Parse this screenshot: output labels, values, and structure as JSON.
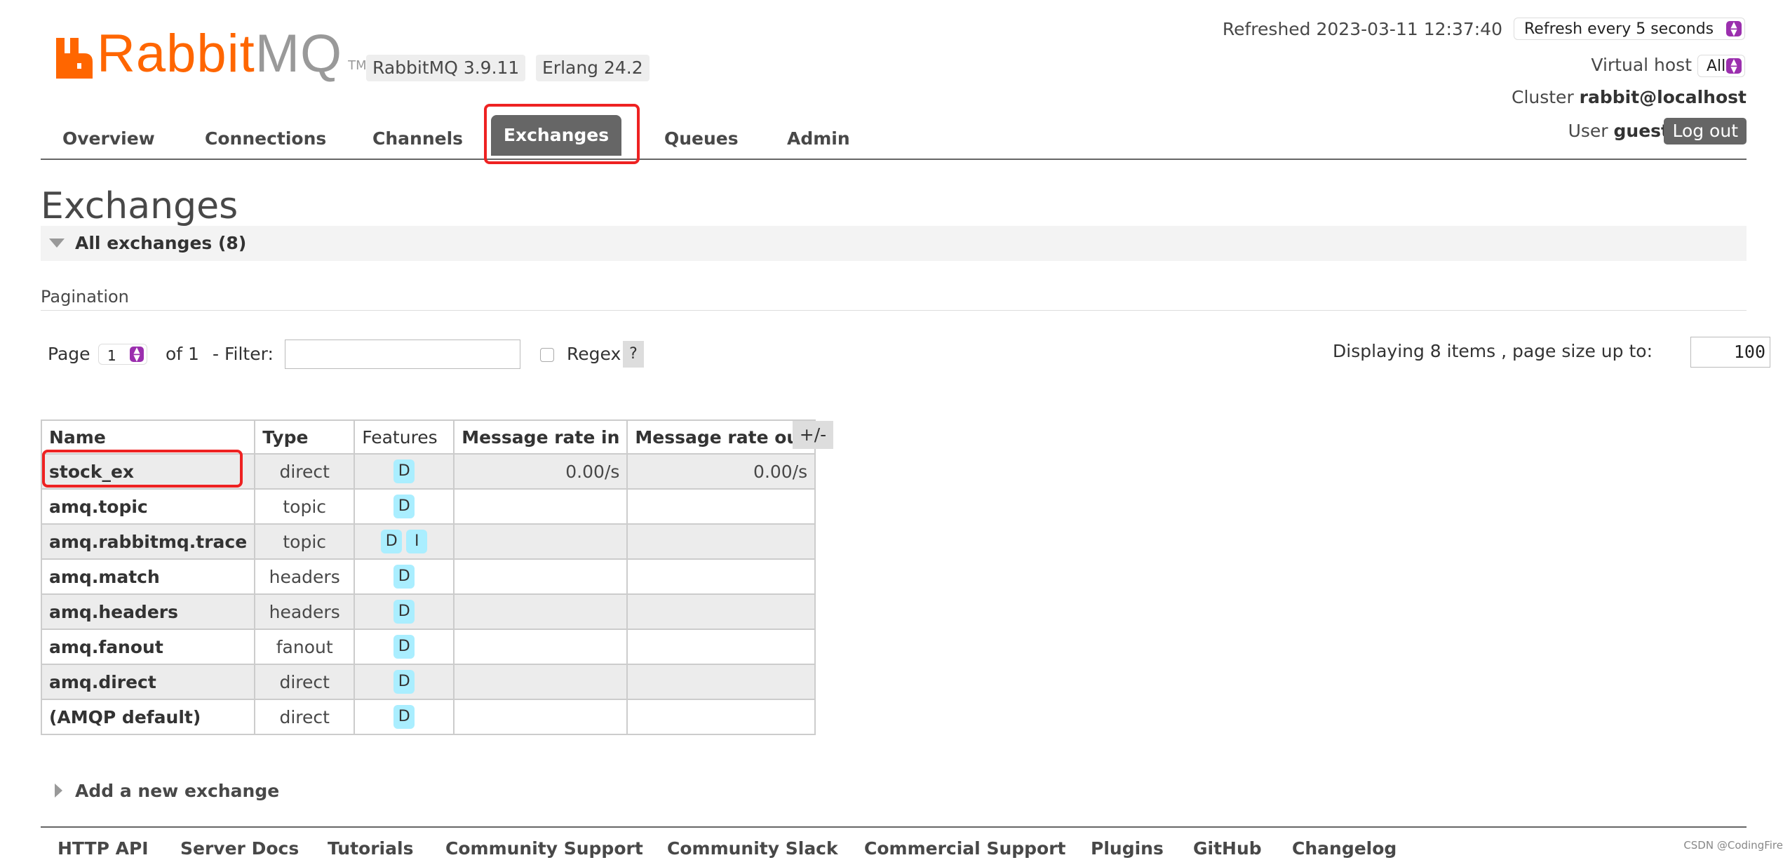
{
  "brand": {
    "primary": "Rabbit",
    "secondary": "MQ",
    "tm": "TM",
    "accent_color": "#ff6600"
  },
  "versions": {
    "rabbitmq": "RabbitMQ 3.9.11",
    "erlang": "Erlang 24.2"
  },
  "status": {
    "refreshed": "Refreshed 2023-03-11 12:37:40",
    "refresh_select": "Refresh every 5 seconds",
    "vhost_label": "Virtual host",
    "vhost_select": "All",
    "cluster_label": "Cluster",
    "cluster_name": "rabbit@localhost",
    "user_label": "User",
    "user_name": "guest",
    "logout": "Log out"
  },
  "nav": {
    "overview": "Overview",
    "connections": "Connections",
    "channels": "Channels",
    "exchanges": "Exchanges",
    "queues": "Queues",
    "admin": "Admin",
    "active": "exchanges"
  },
  "page": {
    "title": "Exchanges",
    "section_title": "All exchanges (8)",
    "pagination_heading": "Pagination"
  },
  "pagination": {
    "page_label": "Page",
    "page_value": "1",
    "of_label": "of 1",
    "filter_label": "- Filter:",
    "filter_value": "",
    "regex_label": "Regex",
    "help": "?",
    "displaying": "Displaying 8 items , page size up to:",
    "page_size": "100"
  },
  "table": {
    "headers": {
      "name": "Name",
      "type": "Type",
      "features": "Features",
      "rate_in": "Message rate in",
      "rate_out": "Message rate out"
    },
    "columns_toggle": "+/-",
    "rows": [
      {
        "name": "stock_ex",
        "type": "direct",
        "features": [
          "D"
        ],
        "rate_in": "0.00/s",
        "rate_out": "0.00/s"
      },
      {
        "name": "amq.topic",
        "type": "topic",
        "features": [
          "D"
        ],
        "rate_in": "",
        "rate_out": ""
      },
      {
        "name": "amq.rabbitmq.trace",
        "type": "topic",
        "features": [
          "D",
          "I"
        ],
        "rate_in": "",
        "rate_out": ""
      },
      {
        "name": "amq.match",
        "type": "headers",
        "features": [
          "D"
        ],
        "rate_in": "",
        "rate_out": ""
      },
      {
        "name": "amq.headers",
        "type": "headers",
        "features": [
          "D"
        ],
        "rate_in": "",
        "rate_out": ""
      },
      {
        "name": "amq.fanout",
        "type": "fanout",
        "features": [
          "D"
        ],
        "rate_in": "",
        "rate_out": ""
      },
      {
        "name": "amq.direct",
        "type": "direct",
        "features": [
          "D"
        ],
        "rate_in": "",
        "rate_out": ""
      },
      {
        "name": "(AMQP default)",
        "type": "direct",
        "features": [
          "D"
        ],
        "rate_in": "",
        "rate_out": ""
      }
    ]
  },
  "add_exchange": "Add a new exchange",
  "footer": {
    "links": [
      "HTTP API",
      "Server Docs",
      "Tutorials",
      "Community Support",
      "Community Slack",
      "Commercial Support",
      "Plugins",
      "GitHub",
      "Changelog"
    ]
  },
  "watermark": "CSDN @CodingFire",
  "highlight_color": "#ee2222"
}
